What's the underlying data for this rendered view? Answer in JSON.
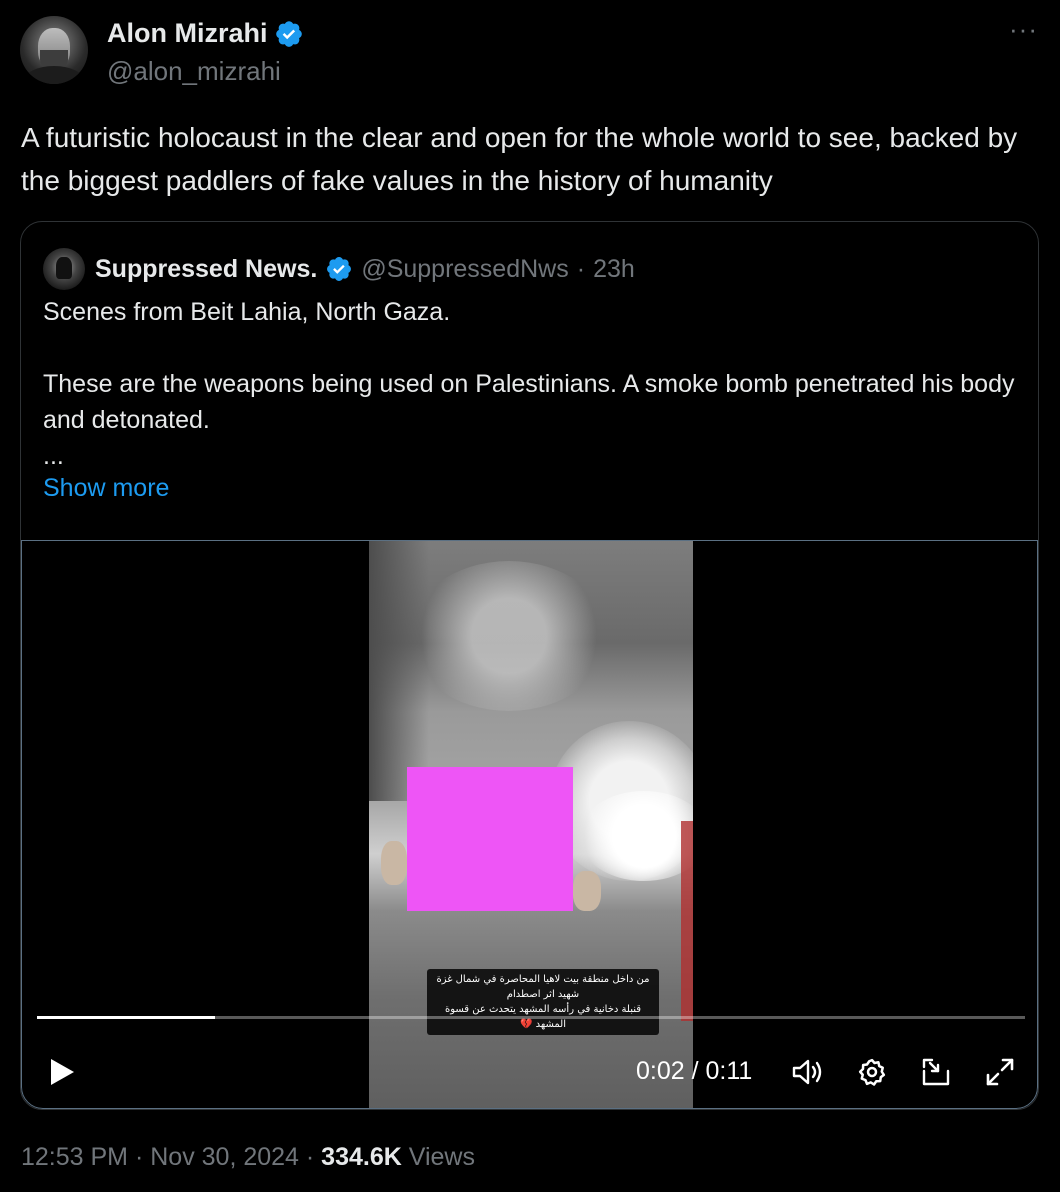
{
  "author": {
    "name": "Alon Mizrahi",
    "handle": "@alon_mizrahi"
  },
  "more_label": "···",
  "tweet_text": "A futuristic holocaust in the clear and open for the whole world to see, backed by the biggest paddlers of fake values in the history of humanity",
  "quote": {
    "name": "Suppressed News.",
    "handle": "@SuppressedNws",
    "separator": "·",
    "time": "23h",
    "line1": "Scenes from Beit Lahia, North Gaza.",
    "line2": "These are the weapons being used on Palestinians. A smoke bomb penetrated his body and detonated.",
    "ellipsis": "...",
    "show_more": "Show more",
    "video": {
      "caption_line1": "من داخل منطقة بيت لاهيا المحاصرة في شمال غزة شهيد اثر اصطدام",
      "caption_line2": "قنبلة دخانية في رأسه المشهد يتحدث عن قسوة المشهد 💔",
      "current_time": "0:02",
      "duration": "0:11",
      "time_separator": " / ",
      "progress_fraction": 0.18
    }
  },
  "footer": {
    "time": "12:53 PM",
    "sep1": " · ",
    "date": "Nov 30, 2024",
    "sep2": " · ",
    "views_count": "334.6K",
    "views_label": " Views"
  },
  "colors": {
    "background": "#000000",
    "text": "#e7e9ea",
    "muted": "#71767b",
    "link": "#1d9bf0",
    "verified": "#1d9bf0",
    "censor": "#ee55f6"
  }
}
